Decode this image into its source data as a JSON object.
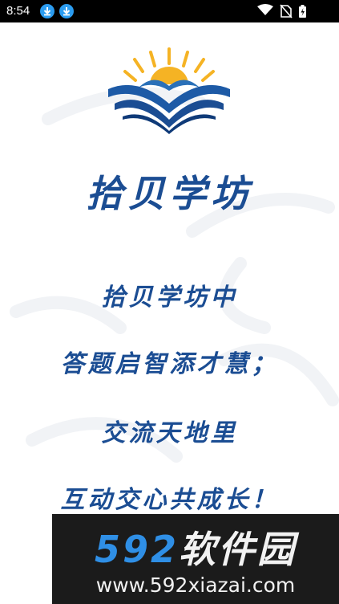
{
  "status_bar": {
    "time": "8:54",
    "notification_icons": [
      "download-icon",
      "download-icon"
    ],
    "system_icons": [
      "wifi-icon",
      "no-sim-icon",
      "battery-charging-icon"
    ]
  },
  "splash": {
    "logo": "book-sunrise-logo",
    "app_name": "拾贝学坊",
    "poem_lines": [
      "拾贝学坊中",
      "答题启智添才慧；",
      "交流天地里",
      "互动交心共成长！"
    ]
  },
  "watermark": {
    "brand_number": "592",
    "brand_text": "软件园",
    "url": "www.592xiazai.com"
  },
  "colors": {
    "primary_blue": "#1b4d93",
    "sun_yellow": "#f5b324",
    "status_bar": "#000000",
    "watermark_bg": "#1b1b1b",
    "watermark_blue": "#2f8fe6"
  }
}
